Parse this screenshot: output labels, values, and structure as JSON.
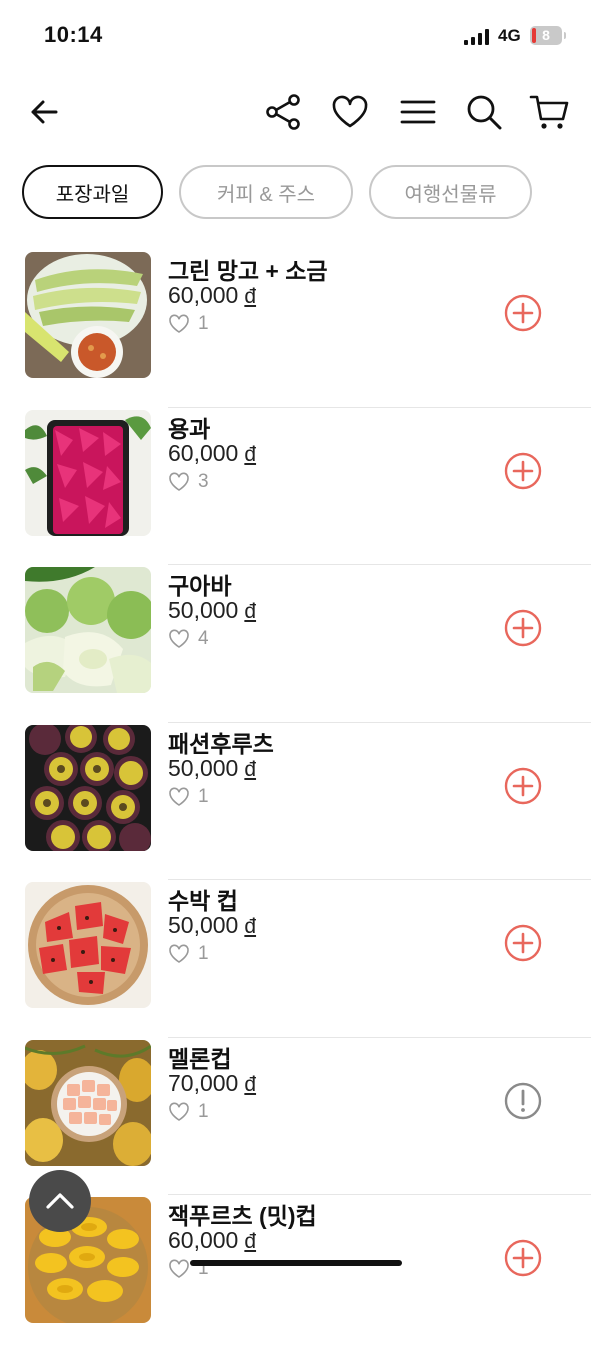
{
  "status": {
    "time": "10:14",
    "network": "4G",
    "battery": "8"
  },
  "header": {
    "back_icon": "arrow-left-icon",
    "actions": [
      "share-icon",
      "heart-icon",
      "menu-icon",
      "search-icon",
      "cart-icon"
    ]
  },
  "tabs": [
    {
      "label": "포장과일",
      "active": true
    },
    {
      "label": "커피 & 주스",
      "active": false
    },
    {
      "label": "여행선물류",
      "active": false
    }
  ],
  "products": [
    {
      "name": "그린 망고 + 소금",
      "price": "60,000",
      "currency": "đ",
      "likes": "1",
      "action": "add"
    },
    {
      "name": "용과",
      "price": "60,000",
      "currency": "đ",
      "likes": "3",
      "action": "add"
    },
    {
      "name": "구아바",
      "price": "50,000",
      "currency": "đ",
      "likes": "4",
      "action": "add"
    },
    {
      "name": "패션후루츠",
      "price": "50,000",
      "currency": "đ",
      "likes": "1",
      "action": "add"
    },
    {
      "name": "수박 컵",
      "price": "50,000",
      "currency": "đ",
      "likes": "1",
      "action": "add"
    },
    {
      "name": "멜론컵",
      "price": "70,000",
      "currency": "đ",
      "likes": "1",
      "action": "unavailable"
    },
    {
      "name": "잭푸르츠 (밋)컵",
      "price": "60,000",
      "currency": "đ",
      "likes": "1",
      "action": "add"
    }
  ],
  "colors": {
    "accent": "#e8675c",
    "muted": "#999999",
    "active_tab_border": "#111111"
  }
}
